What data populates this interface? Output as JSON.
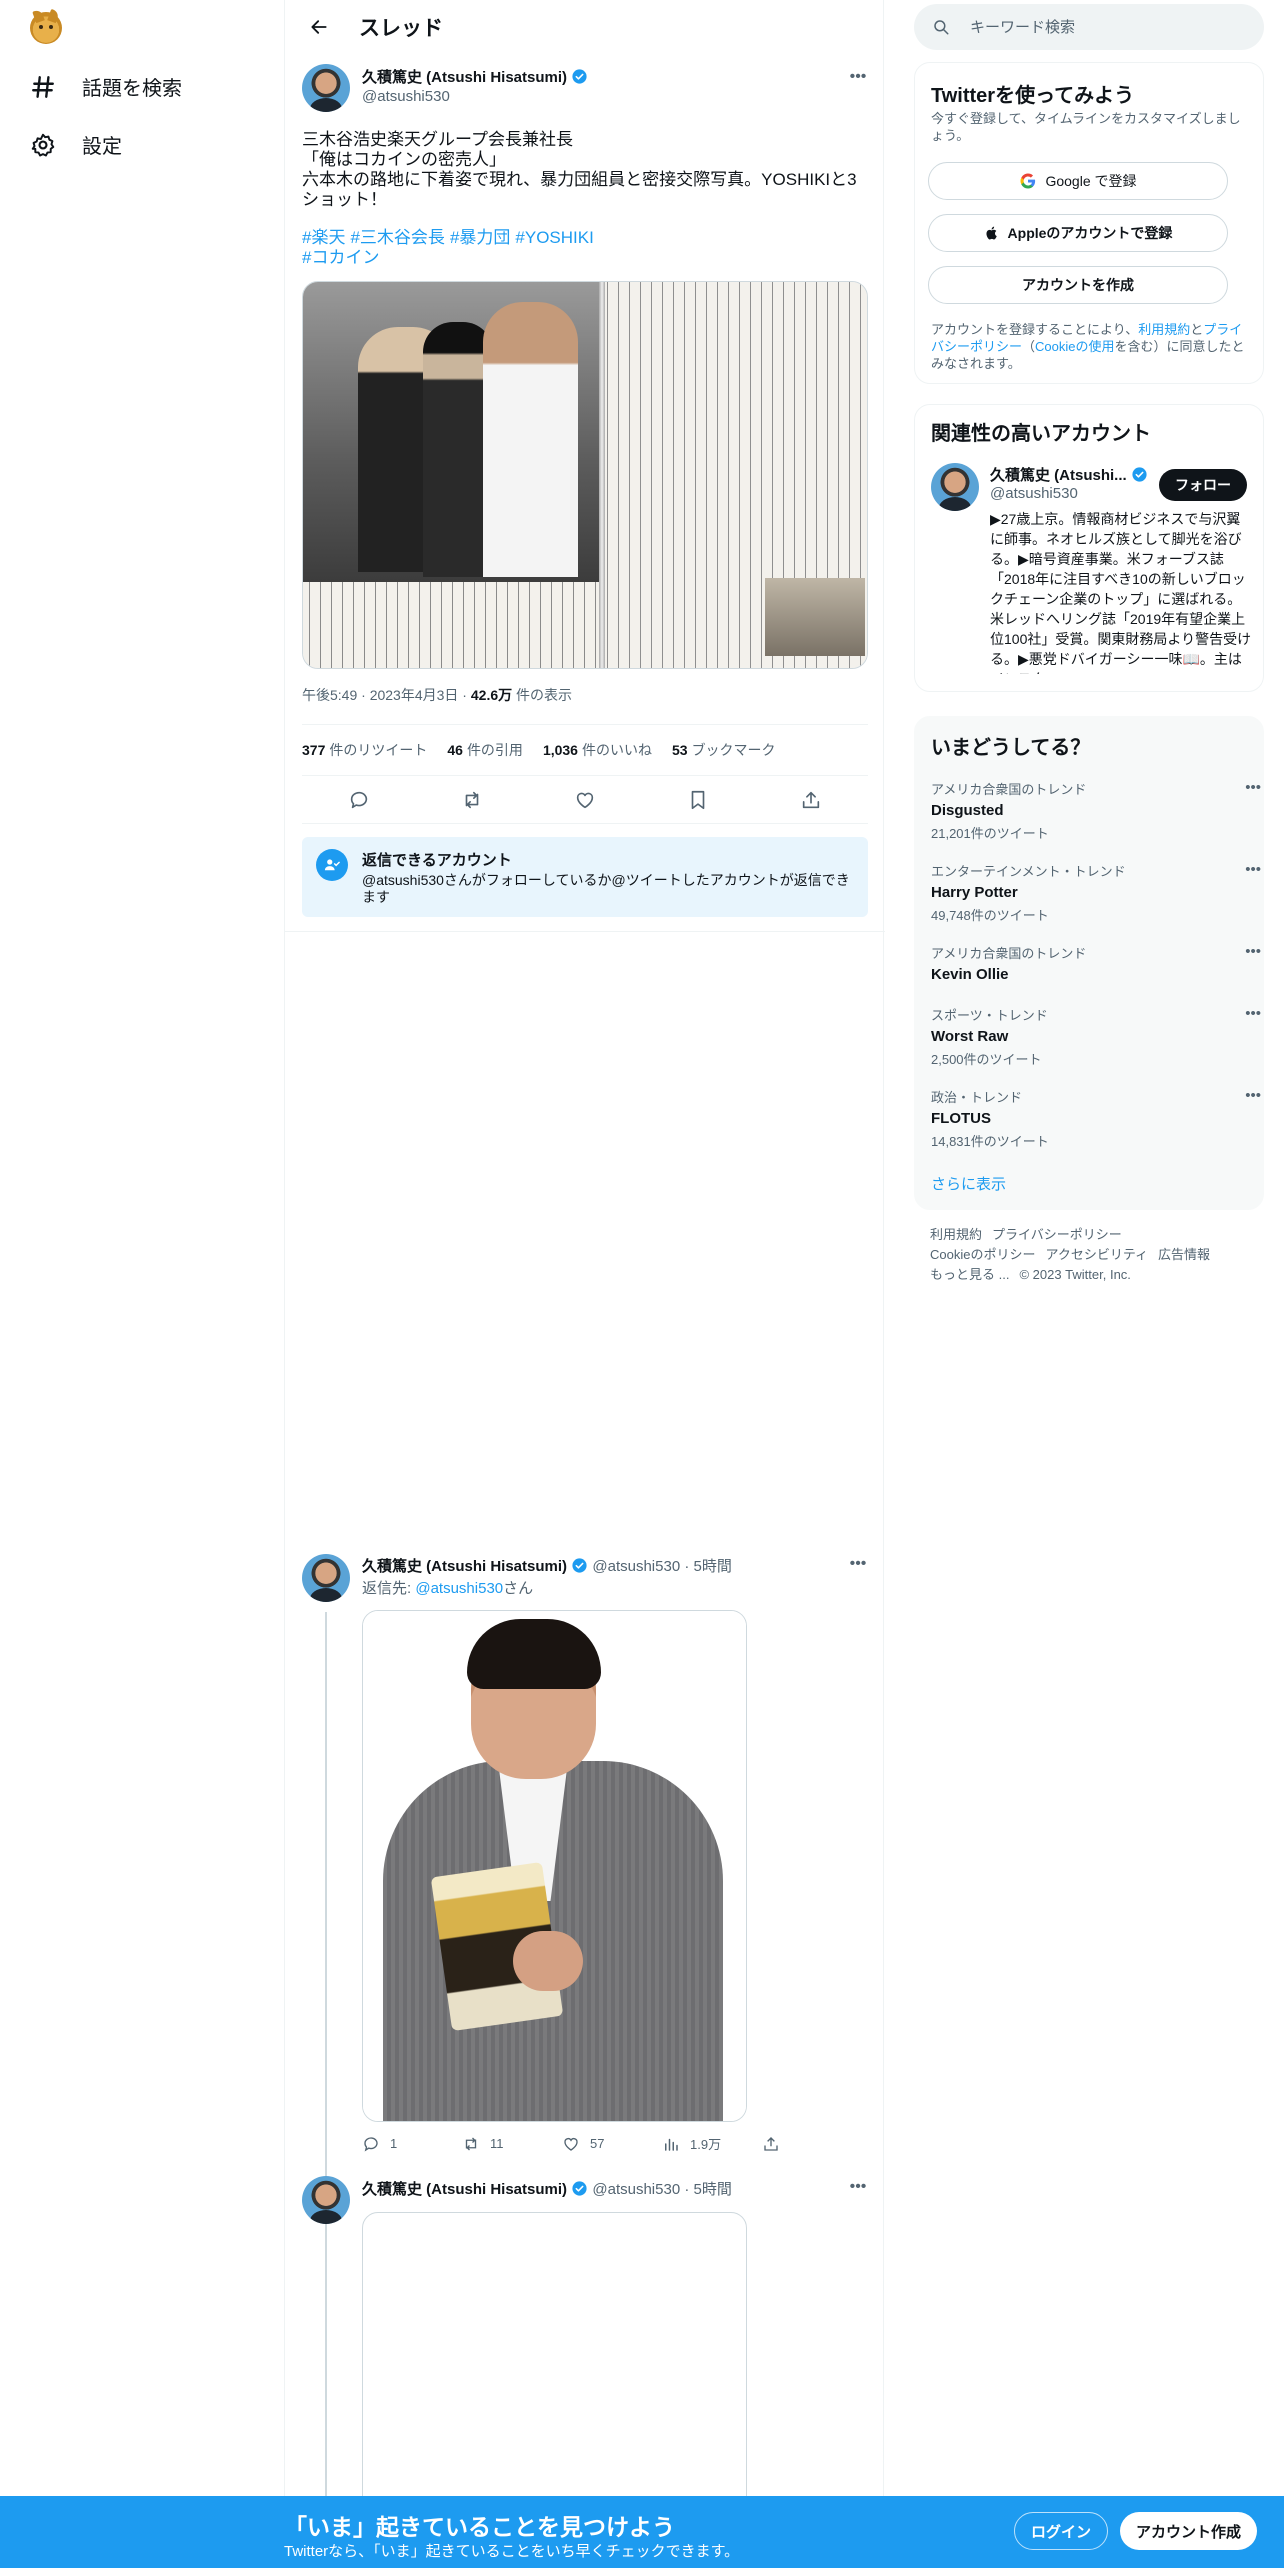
{
  "nav": {
    "items": [
      {
        "label": "話題を検索",
        "icon": "hashtag-icon"
      },
      {
        "label": "設定",
        "icon": "gear-icon"
      }
    ]
  },
  "header": {
    "title": "スレッド"
  },
  "main_tweet": {
    "author_name": "久積篤史 (Atsushi Hisatsumi)",
    "author_handle": "@atsushi530",
    "text": "三木谷浩史楽天グループ会長兼社長\n「俺はコカインの密売人」\n六本木の路地に下着姿で現れ、暴力団組員と密接交際写真。YOSHIKIと3ショット！",
    "hashtags": [
      "#楽天",
      "#三木谷会長",
      "#暴力団",
      "#YOSHIKI",
      "#コカイン"
    ],
    "time": "午後5:49",
    "date": "2023年4月3日",
    "views_number": "42.6万",
    "views_label": "件の表示",
    "stats": [
      {
        "number": "377",
        "label": "件のリツイート"
      },
      {
        "number": "46",
        "label": "件の引用"
      },
      {
        "number": "1,036",
        "label": "件のいいね"
      },
      {
        "number": "53",
        "label": "ブックマーク"
      }
    ]
  },
  "reply_notice": {
    "title": "返信できるアカウント",
    "body": "@atsushi530さんがフォローしているか@ツイートしたアカウントが返信できます"
  },
  "replies": [
    {
      "author_name": "久積篤史 (Atsushi Hisatsumi)",
      "author_handle": "@atsushi530",
      "time": "5時間",
      "reply_to_prefix": "返信先: ",
      "reply_to_handle": "@atsushi530",
      "reply_to_suffix": "さん",
      "counts": {
        "replies": "1",
        "retweets": "11",
        "likes": "57",
        "views": "1.9万"
      }
    },
    {
      "author_name": "久積篤史 (Atsushi Hisatsumi)",
      "author_handle": "@atsushi530",
      "time": "5時間"
    }
  ],
  "search": {
    "placeholder": "キーワード検索"
  },
  "signup_card": {
    "title": "Twitterを使ってみよう",
    "subtitle": "今すぐ登録して、タイムラインをカスタマイズしましょう。",
    "google_label": "Google で登録",
    "apple_label": "Appleのアカウントで登録",
    "create_label": "アカウントを作成",
    "terms_prefix": "アカウントを登録することにより、",
    "terms_link1": "利用規約",
    "terms_and": "と",
    "terms_link2": "プライバシーポリシー",
    "terms_paren_open": "（",
    "terms_link3": "Cookieの使用",
    "terms_suffix": "を含む）に同意したとみなされます。"
  },
  "related": {
    "title": "関連性の高いアカウント",
    "name": "久積篤史 (Atsushi...",
    "handle": "@atsushi530",
    "follow_label": "フォロー",
    "bio": "▶27歳上京。情報商材ビジネスで与沢翼に師事。ネオヒルズ族として脚光を浴びる。▶暗号資産事業。米フォーブス誌「2018年に注目すべき10の新しいブロックチェーン企業のトップ」に選ばれる。米レッドへリング誌「2019年有望企業上位100社」受賞。関東財務局より警告受ける。▶悪党ドバイガーシー一味📖。主はインスタ"
  },
  "trends": {
    "title": "いまどうしてる？",
    "items": [
      {
        "context": "アメリカ合衆国のトレンド",
        "name": "Disgusted",
        "count": "21,201件のツイート"
      },
      {
        "context": "エンターテインメント・トレンド",
        "name": "Harry Potter",
        "count": "49,748件のツイート"
      },
      {
        "context": "アメリカ合衆国のトレンド",
        "name": "Kevin Ollie",
        "count": ""
      },
      {
        "context": "スポーツ・トレンド",
        "name": "Worst Raw",
        "count": "2,500件のツイート"
      },
      {
        "context": "政治・トレンド",
        "name": "FLOTUS",
        "count": "14,831件のツイート"
      }
    ],
    "show_more": "さらに表示"
  },
  "footer": {
    "links": [
      "利用規約",
      "プライバシーポリシー",
      "Cookieのポリシー",
      "アクセシビリティ",
      "広告情報",
      "もっと見る ..."
    ],
    "copyright": "© 2023 Twitter, Inc."
  },
  "banner": {
    "title": "「いま」起きていることを見つけよう",
    "subtitle": "Twitterなら、「いま」起きていることをいち早くチェックできます。",
    "login_label": "ログイン",
    "signup_label": "アカウント作成"
  },
  "colors": {
    "accent": "#1d9bf0",
    "text": "#0f1419",
    "muted": "#536471",
    "border": "#eff3f4"
  }
}
